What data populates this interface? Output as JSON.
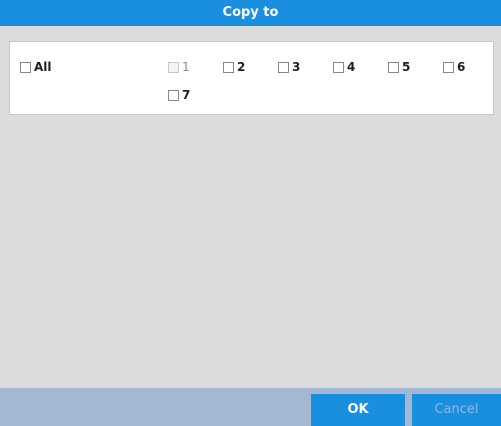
{
  "dialog": {
    "title": "Copy to",
    "all_label": "All",
    "channels": [
      {
        "label": "1",
        "disabled": true
      },
      {
        "label": "2",
        "disabled": false
      },
      {
        "label": "3",
        "disabled": false
      },
      {
        "label": "4",
        "disabled": false
      },
      {
        "label": "5",
        "disabled": false
      },
      {
        "label": "6",
        "disabled": false
      },
      {
        "label": "7",
        "disabled": false
      }
    ],
    "ok_label": "OK",
    "cancel_label": "Cancel"
  },
  "colors": {
    "accent": "#1a8fe0",
    "footer": "#a5b8d2",
    "background": "#dcdcdc"
  }
}
